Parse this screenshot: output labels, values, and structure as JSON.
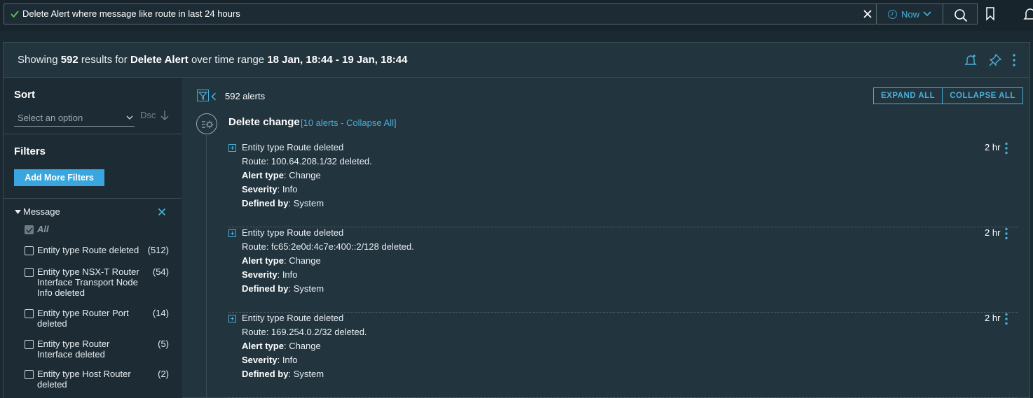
{
  "search": {
    "query": "Delete Alert where message like route in last 24 hours",
    "time_label": "Now"
  },
  "header": {
    "prefix": "Showing",
    "count": "592",
    "mid1": "results for",
    "query": "Delete Alert",
    "mid2": "over time range",
    "range": "18 Jan, 18:44 - 19 Jan, 18:44"
  },
  "sidebar": {
    "sort_label": "Sort",
    "sort_placeholder": "Select an option",
    "sort_dir": "Dsc",
    "filters_label": "Filters",
    "add_filters": "Add More Filters",
    "message_label": "Message",
    "options": [
      {
        "label": "All",
        "count": "",
        "checked": true
      },
      {
        "label": "Entity type Route deleted",
        "count": "(512)",
        "checked": false
      },
      {
        "label": "Entity type NSX-T Router Interface Transport Node Info deleted",
        "count": "(54)",
        "checked": false
      },
      {
        "label": "Entity type Router Port deleted",
        "count": "(14)",
        "checked": false
      },
      {
        "label": "Entity type Router Interface deleted",
        "count": "(5)",
        "checked": false
      },
      {
        "label": "Entity type Host Router deleted",
        "count": "(2)",
        "checked": false
      }
    ]
  },
  "content": {
    "alerts_count": "592 alerts",
    "expand_all": "EXPAND ALL",
    "collapse_all": "COLLAPSE ALL",
    "group_title": "Delete change",
    "group_meta": "[10 alerts - Collapse All]",
    "labels": {
      "alert_type": "Alert type",
      "severity": "Severity",
      "defined_by": "Defined by"
    },
    "alerts": [
      {
        "title": "Entity type Route deleted",
        "detail": "Route: 100.64.208.1/32 deleted.",
        "alert_type": ": Change",
        "severity": ": Info",
        "defined_by": ": System",
        "time": "2 hr"
      },
      {
        "title": "Entity type Route deleted",
        "detail": "Route: fc65:2e0d:4c7e:400::2/128 deleted.",
        "alert_type": ": Change",
        "severity": ": Info",
        "defined_by": ": System",
        "time": "2 hr"
      },
      {
        "title": "Entity type Route deleted",
        "detail": "Route: 169.254.0.2/32 deleted.",
        "alert_type": ": Change",
        "severity": ": Info",
        "defined_by": ": System",
        "time": "2 hr"
      }
    ]
  },
  "colors": {
    "accent": "#49afd9",
    "button": "#3aa6df",
    "background": "#1b2a32",
    "panel": "#22343e",
    "sidebar": "#1d2c34",
    "success": "#5cb85c"
  },
  "icons": {
    "search_status": "check-icon",
    "clear": "close-icon",
    "time": "clock-icon",
    "search": "search-icon",
    "bookmark": "bookmark-icon",
    "notifications": "bell-icon",
    "alert_subscribe": "bell-plus-icon",
    "pin": "pin-icon",
    "more": "kebab-icon",
    "filter": "filter-icon",
    "group": "change-gear-icon"
  }
}
